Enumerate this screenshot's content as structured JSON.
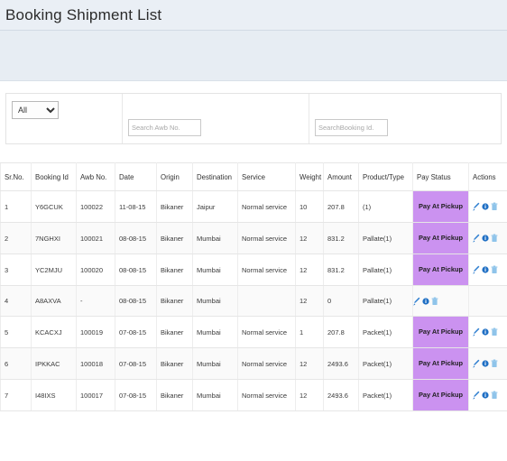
{
  "header": {
    "title": "Booking Shipment List"
  },
  "filters": {
    "status_select": {
      "selected": "All",
      "options": [
        "All"
      ]
    },
    "awb_search": {
      "value": "",
      "placeholder": "Search Awb No."
    },
    "booking_search": {
      "value": "",
      "placeholder": "SearchBooking Id."
    }
  },
  "table": {
    "columns": [
      "Sr.No.",
      "Booking Id",
      "Awb No.",
      "Date",
      "Origin",
      "Destination",
      "Service",
      "Weight",
      "Amount",
      "Product/Type",
      "Pay Status",
      "Actions"
    ],
    "rows": [
      {
        "sr": "1",
        "booking_id": "Y6GCUK",
        "awb_no": "100022",
        "date": "11-08-15",
        "origin": "Bikaner",
        "destination": "Jaipur",
        "service": "Normal service",
        "weight": "10",
        "amount": "207.8",
        "product_type": "(1)",
        "pay_status": "Pay At Pickup"
      },
      {
        "sr": "2",
        "booking_id": "7NGHXI",
        "awb_no": "100021",
        "date": "08-08-15",
        "origin": "Bikaner",
        "destination": "Mumbai",
        "service": "Normal service",
        "weight": "12",
        "amount": "831.2",
        "product_type": "Pallate(1)",
        "pay_status": "Pay At Pickup"
      },
      {
        "sr": "3",
        "booking_id": "YC2MJU",
        "awb_no": "100020",
        "date": "08-08-15",
        "origin": "Bikaner",
        "destination": "Mumbai",
        "service": "Normal service",
        "weight": "12",
        "amount": "831.2",
        "product_type": "Pallate(1)",
        "pay_status": "Pay At Pickup"
      },
      {
        "sr": "4",
        "booking_id": "A8AXVA",
        "awb_no": "-",
        "date": "08-08-15",
        "origin": "Bikaner",
        "destination": "Mumbai",
        "service": "",
        "weight": "12",
        "amount": "0",
        "product_type": "Pallate(1)",
        "pay_status": ""
      },
      {
        "sr": "5",
        "booking_id": "KCACXJ",
        "awb_no": "100019",
        "date": "07-08-15",
        "origin": "Bikaner",
        "destination": "Mumbai",
        "service": "Normal service",
        "weight": "1",
        "amount": "207.8",
        "product_type": "Packet(1)",
        "pay_status": "Pay At Pickup"
      },
      {
        "sr": "6",
        "booking_id": "IPKKAC",
        "awb_no": "100018",
        "date": "07-08-15",
        "origin": "Bikaner",
        "destination": "Mumbai",
        "service": "Normal service",
        "weight": "12",
        "amount": "2493.6",
        "product_type": "Packet(1)",
        "pay_status": "Pay At Pickup"
      },
      {
        "sr": "7",
        "booking_id": "I48IXS",
        "awb_no": "100017",
        "date": "07-08-15",
        "origin": "Bikaner",
        "destination": "Mumbai",
        "service": "Normal service",
        "weight": "12",
        "amount": "2493.6",
        "product_type": "Packet(1)",
        "pay_status": "Pay At Pickup"
      }
    ],
    "action_icons": [
      "edit-pencil-icon",
      "info-icon",
      "delete-trash-icon"
    ]
  },
  "colors": {
    "pay_status_badge": "#cb92f0",
    "title_band": "#eaeff5",
    "sub_band": "#e7edf3",
    "icon_blue": "#2f7fd0",
    "icon_trash": "#8fc4ea"
  }
}
